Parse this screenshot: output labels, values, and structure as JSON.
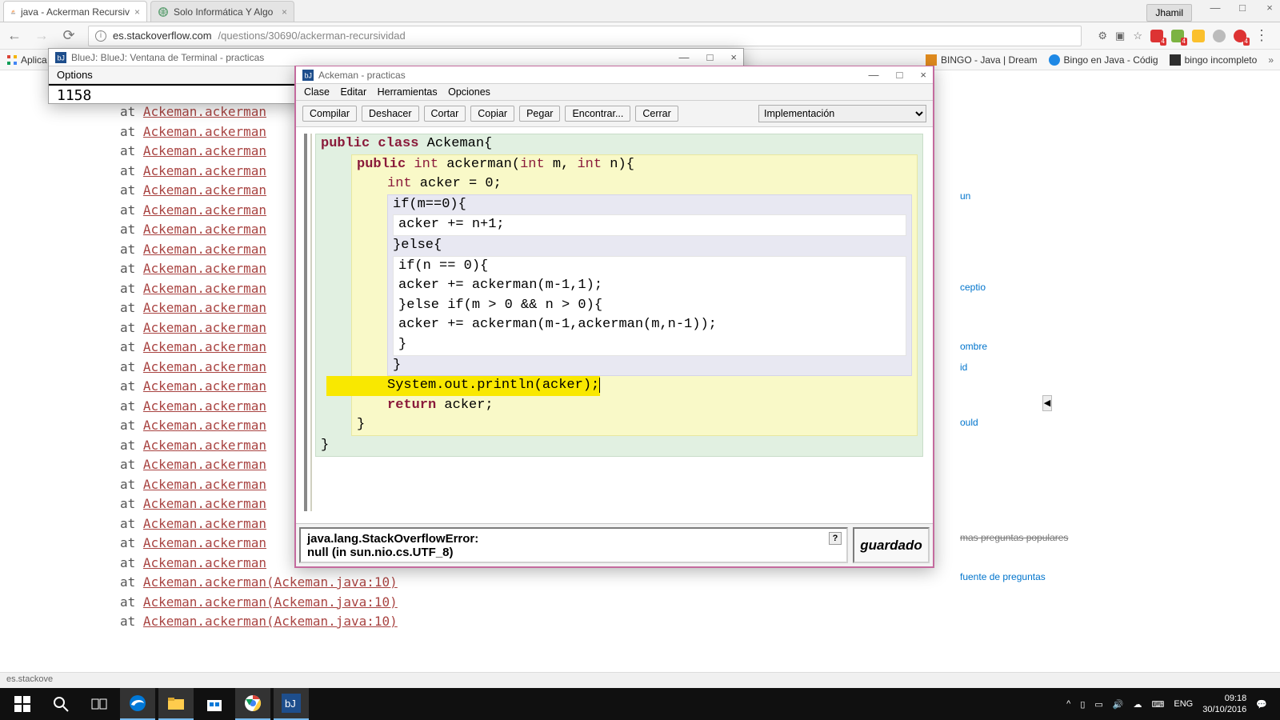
{
  "chrome": {
    "tabs": [
      {
        "title": "java - Ackerman Recursiv",
        "active": true
      },
      {
        "title": "Solo Informática Y Algo",
        "active": false
      }
    ],
    "user_button": "Jhamil",
    "url_host": "es.stackoverflow.com",
    "url_path": "/questions/30690/ackerman-recursividad",
    "bookmarks_label": "Aplica",
    "bookmarks": [
      {
        "label": "BINGO - Java | Dream",
        "color": "#e08b1e"
      },
      {
        "label": "Bingo en Java - Códig",
        "color": "#1e88e5"
      },
      {
        "label": "bingo incompleto",
        "color": "#2e2e2e"
      }
    ]
  },
  "sidebar": {
    "items": [
      "un",
      "ceptio",
      "ombre",
      "id",
      "ould"
    ],
    "link1": "mas preguntas populares",
    "link2": "fuente de preguntas"
  },
  "terminal": {
    "title": "BlueJ: BlueJ:  Ventana de Terminal - practicas",
    "menu_options": "Options",
    "output": "1158"
  },
  "trace": {
    "prefix": "at ",
    "partial": "Ackeman.ackerman",
    "full": "Ackeman.ackerman(Ackeman.java:10)"
  },
  "editor": {
    "title": "Ackeman - practicas",
    "menu": [
      "Clase",
      "Editar",
      "Herramientas",
      "Opciones"
    ],
    "toolbar": {
      "compilar": "Compilar",
      "deshacer": "Deshacer",
      "cortar": "Cortar",
      "copiar": "Copiar",
      "pegar": "Pegar",
      "encontrar": "Encontrar...",
      "cerrar": "Cerrar",
      "view_select": "Implementación"
    },
    "code": {
      "l1_kw1": "public",
      "l1_kw2": "class",
      "l1_name": " Ackeman{",
      "l2_kw1": "public",
      "l2_ty1": "int",
      "l2_name": " ackerman(",
      "l2_ty2": "int",
      "l2_p1": " m, ",
      "l2_ty3": "int",
      "l2_p2": " n){",
      "l3_ty": "int",
      "l3_rest": " acker = 0;",
      "l4": "if(m==0){",
      "l5": "    acker += n+1;",
      "l6": "}else{",
      "l7": "    if(n == 0){",
      "l8": "        acker += ackerman(m-1,1);",
      "l9": "    }else if(m > 0 && n > 0){",
      "l10": "        acker += ackerman(m-1,ackerman(m,n-1));",
      "l11": "    }",
      "l12": "}",
      "l13": "System.out.println(acker);",
      "l14_kw": "return",
      "l14_rest": " acker;",
      "l15": "}",
      "l16": "}"
    },
    "error_line1": "java.lang.StackOverflowError:",
    "error_line2": "null (in sun.nio.cs.UTF_8)",
    "saved": "guardado"
  },
  "status_strip": "es.stackove",
  "taskbar": {
    "lang": "ENG",
    "time": "09:18",
    "date": "30/10/2016"
  }
}
